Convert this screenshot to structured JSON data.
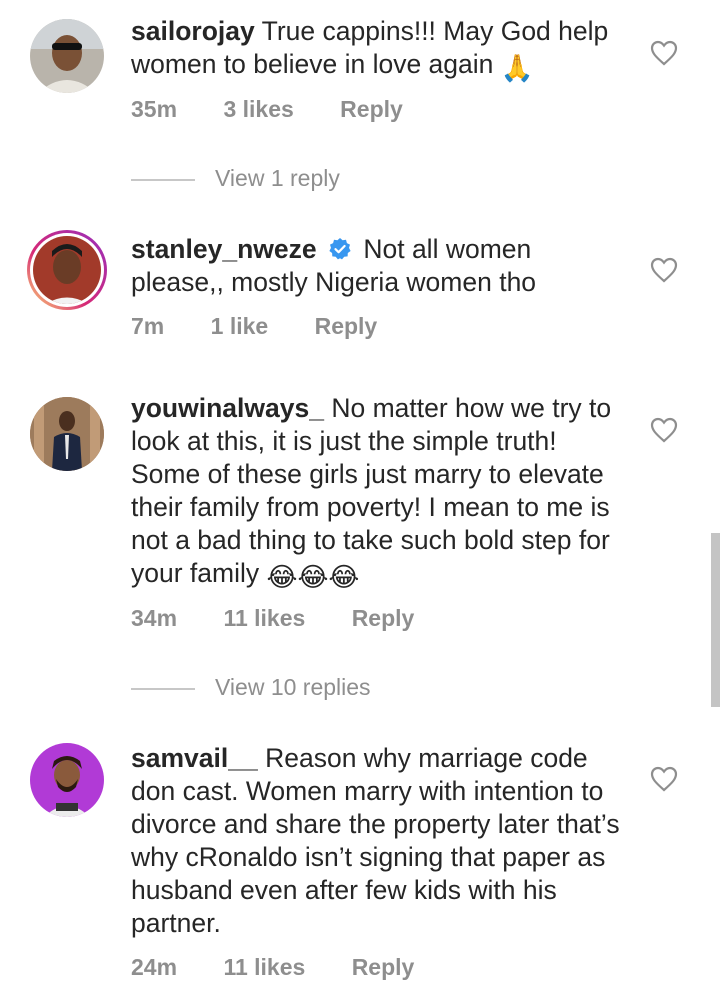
{
  "comments": [
    {
      "username": "sailorojay",
      "text": "True cappins!!! May God help women to believe in love again",
      "emoji": "🙏",
      "time": "35m",
      "likes": "3 likes",
      "reply": "Reply",
      "view_replies": "View 1 reply"
    },
    {
      "username": "stanley_nweze",
      "verified": true,
      "text": "Not all women please,, mostly Nigeria women tho",
      "time": "7m",
      "likes": "1 like",
      "reply": "Reply"
    },
    {
      "username": "youwinalways_",
      "text": "No matter how we try to look at this, it is just the simple truth! Some of these girls just marry to elevate their family from poverty! I mean to me is not a bad thing to take such bold step for your family",
      "emoji": "😂😂😂",
      "time": "34m",
      "likes": "11 likes",
      "reply": "Reply",
      "view_replies": "View 10 replies"
    },
    {
      "username": "samvail__",
      "text": "Reason why marriage code don cast. Women marry with intention to divorce and share the property later that’s why cRonaldo isn’t signing that paper as husband even after few kids with his partner.",
      "time": "24m",
      "likes": "11 likes",
      "reply": "Reply"
    }
  ],
  "colors": {
    "text": "#262626",
    "meta": "#8e8e8e",
    "verified": "#3897f0",
    "story_ring": "#c13584"
  },
  "icons": [
    "heart-outline-icon",
    "verified-badge-icon"
  ]
}
